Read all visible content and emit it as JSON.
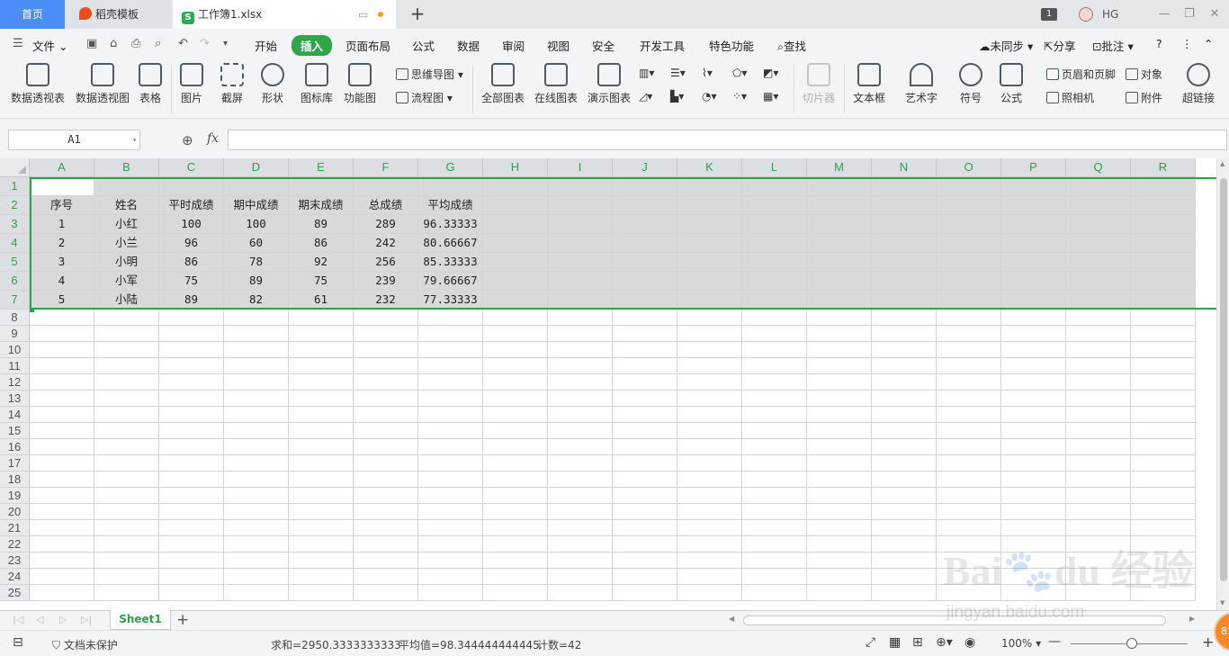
{
  "titlebar": {
    "tabs": [
      {
        "label": "首页"
      },
      {
        "label": "稻壳模板"
      },
      {
        "label": "工作簿1.xlsx"
      }
    ],
    "window_count": "1",
    "user": "HG"
  },
  "menu": {
    "file": "文件",
    "items": [
      "开始",
      "插入",
      "页面布局",
      "公式",
      "数据",
      "审阅",
      "视图",
      "安全",
      "开发工具",
      "特色功能"
    ],
    "search": "查找",
    "sync": "未同步",
    "share": "分享",
    "comment": "批注"
  },
  "ribbon": {
    "big": [
      "数据透视表",
      "数据透视图",
      "表格",
      "图片",
      "截屏",
      "形状",
      "图标库",
      "功能图",
      "全部图表",
      "在线图表",
      "演示图表",
      "切片器",
      "文本框",
      "艺术字",
      "符号",
      "公式",
      "超链接"
    ],
    "small": {
      "mindmap": "思维导图",
      "flowchart": "流程图",
      "header_footer": "页眉和页脚",
      "object": "对象",
      "camera": "照相机",
      "attachment": "附件"
    }
  },
  "formula_bar": {
    "name_box": "A1",
    "fx": "fx",
    "formula": ""
  },
  "grid": {
    "columns": [
      "A",
      "B",
      "C",
      "D",
      "E",
      "F",
      "G",
      "H",
      "I",
      "J",
      "K",
      "L",
      "M",
      "N",
      "O",
      "P",
      "Q",
      "R"
    ],
    "rows": [
      "1",
      "2",
      "3",
      "4",
      "5",
      "6",
      "7",
      "8",
      "9",
      "10",
      "11",
      "12",
      "13",
      "14",
      "15",
      "16",
      "17",
      "18",
      "19",
      "20",
      "21",
      "22",
      "23",
      "24",
      "25"
    ],
    "data": [
      [
        "",
        "",
        "",
        "",
        "",
        "",
        ""
      ],
      [
        "序号",
        "姓名",
        "平时成绩",
        "期中成绩",
        "期末成绩",
        "总成绩",
        "平均成绩"
      ],
      [
        "1",
        "小红",
        "100",
        "100",
        "89",
        "289",
        "96.33333"
      ],
      [
        "2",
        "小兰",
        "96",
        "60",
        "86",
        "242",
        "80.66667"
      ],
      [
        "3",
        "小明",
        "86",
        "78",
        "92",
        "256",
        "85.33333"
      ],
      [
        "4",
        "小军",
        "75",
        "89",
        "75",
        "239",
        "79.66667"
      ],
      [
        "5",
        "小陆",
        "89",
        "82",
        "61",
        "232",
        "77.33333"
      ]
    ]
  },
  "sheets": {
    "active": "Sheet1"
  },
  "status": {
    "protect": "文档未保护",
    "sum": "求和=2950.3333333333",
    "avg": "平均值=98.344444444445",
    "count": "计数=42",
    "zoom": "100%"
  },
  "colors": {
    "accent": "#2ea14b",
    "home_tab": "#4a8df6",
    "selection_fill": "#d9d9d9"
  }
}
